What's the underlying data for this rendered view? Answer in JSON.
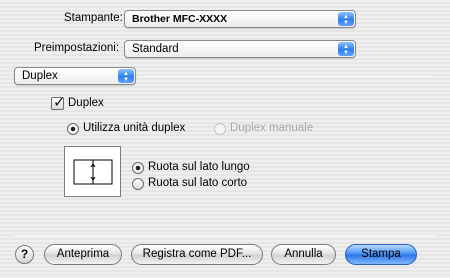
{
  "printer": {
    "label": "Stampante:",
    "value": "Brother MFC-XXXX"
  },
  "presets": {
    "label": "Preimpostazioni:",
    "value": "Standard"
  },
  "panel": {
    "value": "Duplex"
  },
  "duplex": {
    "checkbox_label": "Duplex",
    "checked": true,
    "mode_auto": "Utilizza unità duplex",
    "mode_manual": "Duplex manuale",
    "binding_long": "Ruota sul lato lungo",
    "binding_short": "Ruota sul lato corto"
  },
  "buttons": {
    "help": "?",
    "preview": "Anteprima",
    "save_pdf": "Registra come PDF...",
    "cancel": "Annulla",
    "print": "Stampa"
  },
  "icons": {
    "popup_arrows": "updown-arrows-icon",
    "check": "checkmark-icon",
    "binding_preview": "long-edge-binding-icon"
  },
  "colors": {
    "accent": "#2f7ef0",
    "window_bg": "#ececec"
  }
}
